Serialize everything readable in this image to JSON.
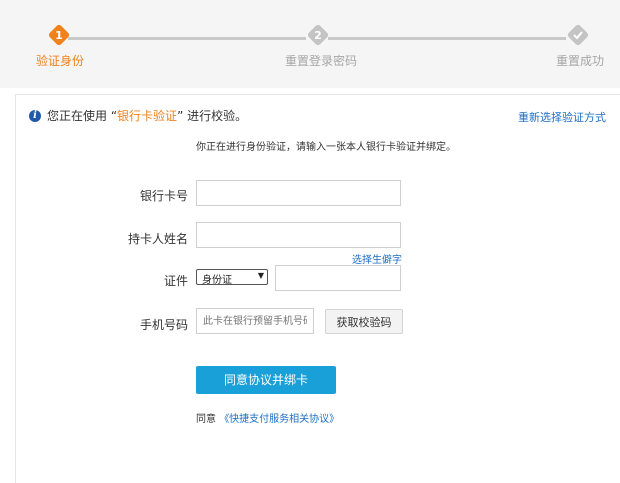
{
  "steps": [
    {
      "number": "1",
      "label": "验证身份",
      "state": "active"
    },
    {
      "number": "2",
      "label": "重置登录密码",
      "state": "pending"
    },
    {
      "number": "",
      "label": "重置成功",
      "state": "pending",
      "icon": "check-icon"
    }
  ],
  "notice": {
    "prefix": "您正在使用 “",
    "method": "银行卡验证",
    "suffix": "” 进行校验。",
    "reselect_link": "重新选择验证方式"
  },
  "hint": "你正在进行身份验证，请输入一张本人银行卡验证并绑定。",
  "form": {
    "card_number_label": "银行卡号",
    "card_number_value": "",
    "holder_name_label": "持卡人姓名",
    "holder_name_value": "",
    "rare_char_link": "选择生僻字",
    "id_label": "证件",
    "id_type_selected": "身份证",
    "id_number_value": "",
    "phone_label": "手机号码",
    "phone_placeholder": "此卡在银行预留手机号码",
    "get_code_button": "获取校验码",
    "submit_button": "同意协议并绑卡"
  },
  "agreement": {
    "prefix": "同意",
    "link": "《快捷支付服务相关协议》"
  },
  "colors": {
    "accent": "#f0821e",
    "link": "#1e6fc5",
    "primary_button": "#1aa0d8",
    "step_inactive": "#c4c4c4"
  }
}
